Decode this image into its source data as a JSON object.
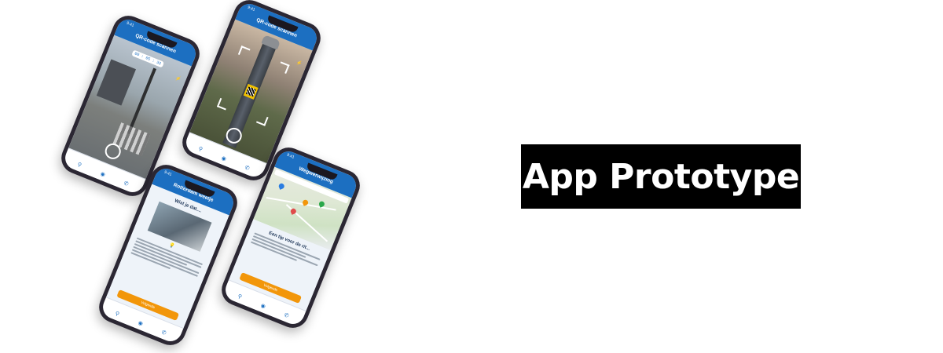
{
  "headline": "App Prototype",
  "colors": {
    "brand_blue": "#1c6fc1",
    "accent_orange": "#f2960a",
    "headline_bg": "#000000"
  },
  "status_time": "9:41",
  "tabs": [
    {
      "icon": "location-pin-icon"
    },
    {
      "icon": "camera-icon"
    },
    {
      "icon": "phone-icon"
    }
  ],
  "phones": {
    "photo_timer": {
      "title": "QR-code scannen",
      "timer": "00 : 05 : 32"
    },
    "qr_scan": {
      "title": "QR-code scannen"
    },
    "info": {
      "title": "Rotterdam weetje",
      "heading": "Wist je dat....",
      "button": "Volgende"
    },
    "map": {
      "title": "Wegwerwijzing",
      "heading": "Een tip voor de rit...",
      "button": "Volgende"
    }
  }
}
